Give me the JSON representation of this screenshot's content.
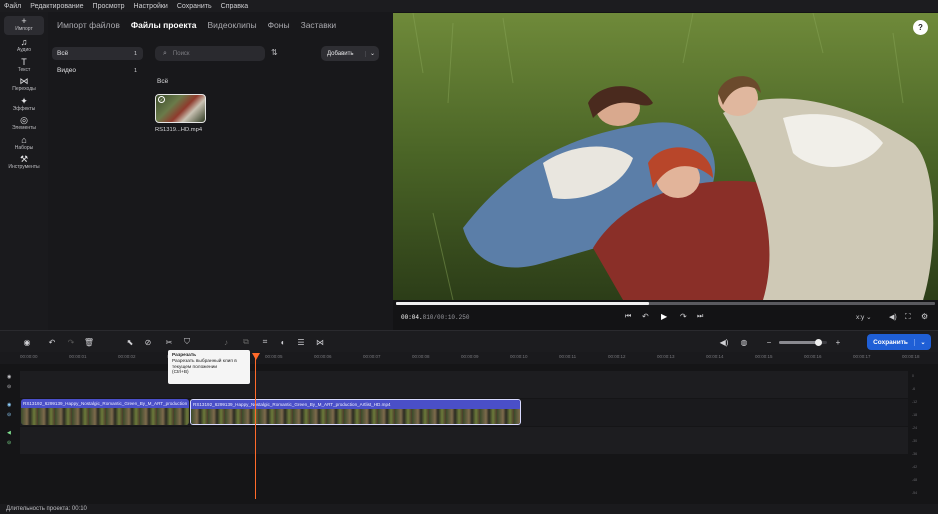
{
  "menu": [
    "Файл",
    "Редактирование",
    "Просмотр",
    "Настройки",
    "Сохранить",
    "Справка"
  ],
  "rail": [
    {
      "label": "Импорт",
      "icon": "plus-icon"
    },
    {
      "label": "Аудио",
      "icon": "music-icon"
    },
    {
      "label": "Текст",
      "icon": "text-icon"
    },
    {
      "label": "Переходы",
      "icon": "transitions-icon"
    },
    {
      "label": "Эффекты",
      "icon": "sparkle-icon"
    },
    {
      "label": "Элементы",
      "icon": "elements-icon"
    },
    {
      "label": "Наборы",
      "icon": "sets-icon"
    },
    {
      "label": "Инструменты",
      "icon": "tools-icon"
    }
  ],
  "media": {
    "tabs": [
      "Импорт файлов",
      "Файлы проекта",
      "Видеоклипы",
      "Фоны",
      "Заставки"
    ],
    "active_tab": 1,
    "folders": [
      {
        "label": "Всё",
        "count": "1"
      },
      {
        "label": "Видео",
        "count": "1"
      }
    ],
    "search_placeholder": "Поиск",
    "add_label": "Добавить",
    "group_label": "Всё",
    "file_name": "RS1319...HD.mp4"
  },
  "preview": {
    "time_current": "00:04.",
    "time_rest": "810/00:10.250",
    "progress": 0.47,
    "aspect": "x:y"
  },
  "timeline": {
    "save_label": "Сохранить",
    "ruler": [
      "00:00:00",
      "00:00:01",
      "00:00:02",
      "00:00:03",
      "00:00:04",
      "00:00:05",
      "00:00:06",
      "00:00:07",
      "00:00:08",
      "00:00:09",
      "00:00:10",
      "00:00:11",
      "00:00:12",
      "00:00:13",
      "00:00:14",
      "00:00:15",
      "00:00:16",
      "00:00:17",
      "00:00:18"
    ],
    "clip1_name": "RS13192_6299139_Happy_Nostalgic_Romantic_Green_By_M_ART_production",
    "clip2_name": "RS13192_6299139_Happy_Nostalgic_Romantic_Green_By_M_ART_production_Artlist_HD.mp4",
    "tooltip_title": "Разрезать",
    "tooltip_body": "Разрезать выбранный клип в текущем положении",
    "tooltip_shortcut": "(Ctrl+B)",
    "meter": [
      "0",
      "-6",
      "-12",
      "-18",
      "-24",
      "-30",
      "-36",
      "-42",
      "-48",
      "-54"
    ]
  },
  "status": "Длительность проекта: 00:10",
  "colors": {
    "accent": "#1f5fd6",
    "clip": "#4a4fc8",
    "playhead": "#ff6a2a"
  }
}
